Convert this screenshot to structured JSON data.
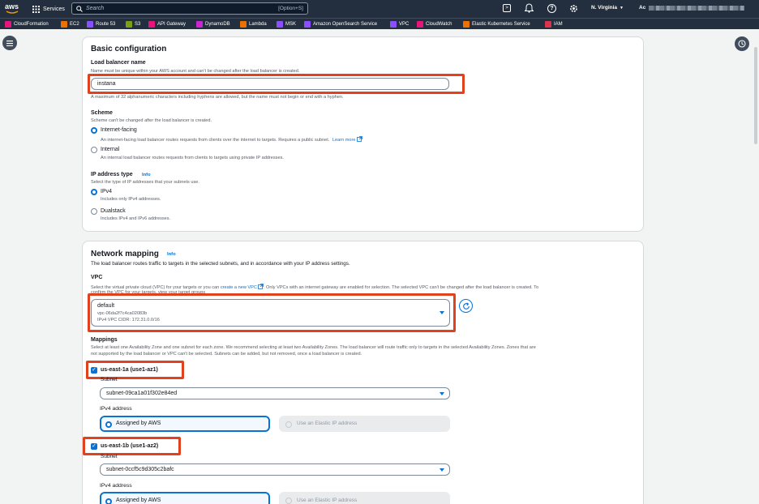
{
  "topbar": {
    "logo": "aws",
    "services": "Services",
    "search_placeholder": "Search",
    "search_shortcut": "[Option+S]",
    "region": "N. Virginia",
    "account": "Ac"
  },
  "favorites": [
    {
      "label": "CloudFormation",
      "color": "#e7157b"
    },
    {
      "label": "EC2",
      "color": "#ed7100"
    },
    {
      "label": "Route 53",
      "color": "#8c4fff"
    },
    {
      "label": "S3",
      "color": "#7aa116"
    },
    {
      "label": "API Gateway",
      "color": "#e7157b"
    },
    {
      "label": "DynamoDB",
      "color": "#c925d1"
    },
    {
      "label": "Lambda",
      "color": "#ed7100"
    },
    {
      "label": "MSK",
      "color": "#8c4fff"
    },
    {
      "label": "Amazon OpenSearch Service",
      "color": "#8c4fff"
    },
    {
      "label": "VPC",
      "color": "#8c4fff"
    },
    {
      "label": "CloudWatch",
      "color": "#e7157b"
    },
    {
      "label": "Elastic Kubernetes Service",
      "color": "#ed7100"
    },
    {
      "label": "IAM",
      "color": "#dd344c"
    }
  ],
  "basic": {
    "title": "Basic configuration",
    "name_label": "Load balancer name",
    "name_desc": "Name must be unique within your AWS account and can't be changed after the load balancer is created.",
    "name_value": "instana",
    "name_hint": "A maximum of 32 alphanumeric characters including hyphens are allowed, but the name must not begin or end with a hyphen.",
    "scheme_label": "Scheme",
    "scheme_desc": "Scheme can't be changed after the load balancer is created.",
    "internet_facing": "Internet-facing",
    "internet_facing_desc": "An internet-facing load balancer routes requests from clients over the internet to targets. Requires a public subnet.",
    "learn_more": "Learn more",
    "internal": "Internal",
    "internal_desc": "An internal load balancer routes requests from clients to targets using private IP addresses.",
    "ip_label": "IP address type",
    "ip_info": "Info",
    "ip_desc": "Select the type of IP addresses that your subnets use.",
    "ipv4": "IPv4",
    "ipv4_desc": "Includes only IPv4 addresses.",
    "dualstack": "Dualstack",
    "dualstack_desc": "Includes IPv4 and IPv6 addresses."
  },
  "network": {
    "title": "Network mapping",
    "info": "Info",
    "desc": "The load balancer routes traffic to targets in the selected subnets, and in accordance with your IP address settings.",
    "vpc_label": "VPC",
    "vpc_desc_a": "Select the virtual private cloud (VPC) for your targets or you can",
    "vpc_desc_link": "create a new VPC",
    "vpc_desc_b": ". Only VPCs with an internet gateway are enabled for selection. The selected VPC can't be changed after the load balancer is created. To",
    "vpc_desc_c": "confirm the VPC for your targets, view your target groups",
    "vpc_name": "default",
    "vpc_id": "vpc-06da2f7c4ca02083b",
    "vpc_cidr": "IPv4 VPC CIDR: 172.31.0.0/16",
    "mappings_label": "Mappings",
    "mappings_desc_1": "Select at least one Availability Zone and one subnet for each zone. We recommend selecting at least two Availability Zones. The load balancer will route traffic only to targets in the selected Availability Zones. Zones that are",
    "mappings_desc_2": "not supported by the load balancer or VPC can't be selected. Subnets can be added, but not removed, once a load balancer is created.",
    "zones": [
      {
        "name": "us-east-1a (use1-az1)",
        "subnet_label": "Subnet",
        "subnet": "subnet-09ca1a01f302e84ed",
        "ipv4_label": "IPv4 address",
        "assigned": "Assigned by AWS",
        "elastic": "Use an Elastic IP address"
      },
      {
        "name": "us-east-1b (use1-az2)",
        "subnet_label": "Subnet",
        "subnet": "subnet-0ccf5c9d305c2bafc",
        "ipv4_label": "IPv4 address",
        "assigned": "Assigned by AWS",
        "elastic": "Use an Elastic IP address"
      }
    ]
  },
  "colors": {
    "highlight": "#e0421f",
    "accent": "#0972d3",
    "nav": "#232f3e"
  }
}
